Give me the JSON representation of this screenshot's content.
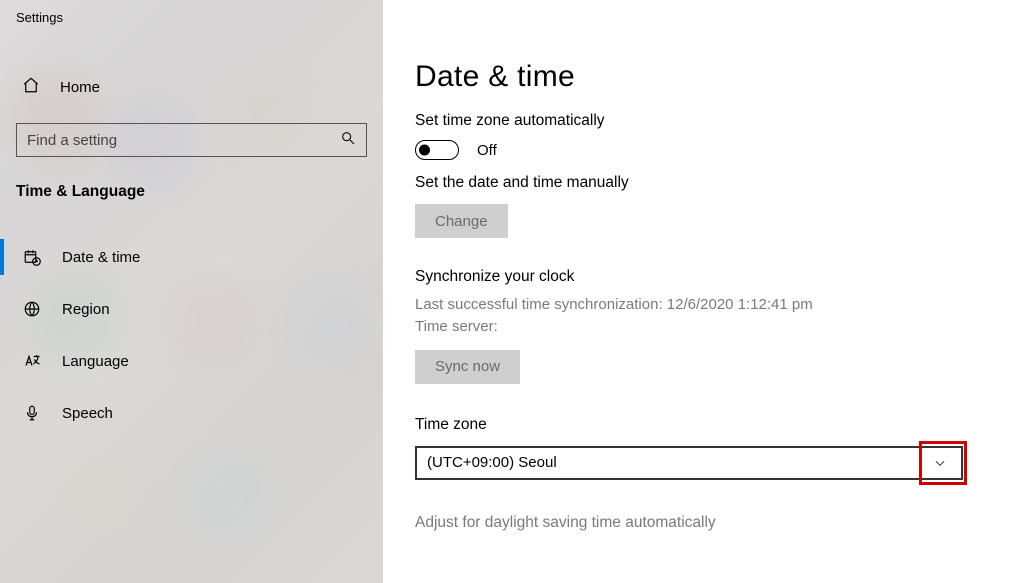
{
  "window": {
    "title": "Settings"
  },
  "sidebar": {
    "home": "Home",
    "search_placeholder": "Find a setting",
    "section_title": "Time & Language",
    "items": [
      {
        "label": "Date & time",
        "active": true
      },
      {
        "label": "Region"
      },
      {
        "label": "Language"
      },
      {
        "label": "Speech"
      }
    ]
  },
  "page": {
    "title": "Date & time",
    "auto_tz_label": "Set time zone automatically",
    "auto_tz_state": "Off",
    "manual_label": "Set the date and time manually",
    "change_btn": "Change",
    "sync": {
      "title": "Synchronize your clock",
      "last_label": "Last successful time synchronization:",
      "last_value": "12/6/2020 1:12:41 pm",
      "server_label": "Time server:",
      "btn": "Sync now"
    },
    "tz": {
      "label": "Time zone",
      "value": "(UTC+09:00) Seoul"
    },
    "dst_label": "Adjust for daylight saving time automatically"
  }
}
